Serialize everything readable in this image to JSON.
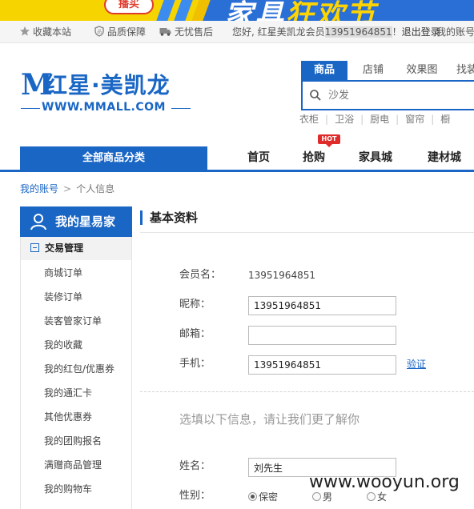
{
  "banner": {
    "badge_text": "播买",
    "text_white": "家具",
    "text_yellow": "狂欢节"
  },
  "topbar": {
    "favorite": "收藏本站",
    "quality": "品质保障",
    "aftersale": "无忧售后",
    "greeting": "您好, 红星美凯龙会员",
    "phone": "13951964851",
    "phone_suffix": "！",
    "logout": "退出登录",
    "account": "我的账号"
  },
  "logo": {
    "mark": "M",
    "name": "红星·美凯龙",
    "url": "WWW.MMALL.COM"
  },
  "search": {
    "tabs": [
      "商品",
      "店铺",
      "效果图",
      "找装"
    ],
    "placeholder": "沙发",
    "hotwords": [
      "衣柜",
      "卫浴",
      "厨电",
      "窗帘",
      "橱"
    ]
  },
  "nav": {
    "all_categories": "全部商品分类",
    "items": [
      "首页",
      "抢购",
      "家具城",
      "建材城"
    ],
    "hot_badge": "HOT"
  },
  "breadcrumb": {
    "home": "我的账号",
    "current": "个人信息"
  },
  "sidebar": {
    "title": "我的星易家",
    "group": "交易管理",
    "items": [
      "商城订单",
      "装修订单",
      "装客管家订单",
      "我的收藏",
      "我的红包/优惠券",
      "我的通汇卡",
      "其他优惠券",
      "我的团购报名",
      "满赠商品管理",
      "我的购物车"
    ]
  },
  "profile": {
    "section_title": "基本资料",
    "username_label": "会员名：",
    "username_value": "13951964851",
    "nickname_label": "昵称：",
    "nickname_value": "13951964851",
    "email_label": "邮箱：",
    "email_value": "",
    "phone_label": "手机：",
    "phone_value": "13951964851",
    "verify_link": "验证",
    "optional_hint": "选填以下信息，请让我们更了解你",
    "name_label": "姓名：",
    "name_value": "刘先生",
    "gender_label": "性别：",
    "gender_options": [
      "保密",
      "男",
      "女"
    ],
    "gender_selected": "保密"
  },
  "watermark": "www.wooyun.org",
  "colors": {
    "brand_blue": "#1a66c5",
    "hot_red": "#e02b2b",
    "banner_yellow": "#f5d400"
  }
}
